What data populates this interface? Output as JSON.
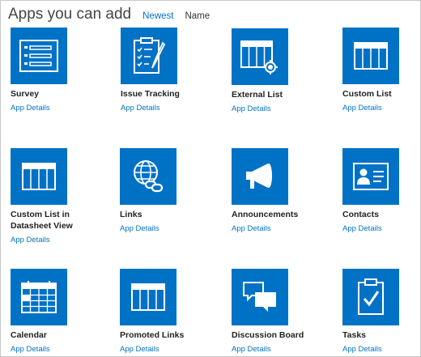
{
  "header": {
    "title": "Apps you can add",
    "sort_newest": "Newest",
    "sort_name": "Name"
  },
  "apps": [
    {
      "name": "Survey",
      "details": "App Details",
      "icon": "survey-icon"
    },
    {
      "name": "Issue Tracking",
      "details": "App Details",
      "icon": "issue-tracking-icon"
    },
    {
      "name": "External List",
      "details": "App Details",
      "icon": "external-list-icon"
    },
    {
      "name": "Custom List",
      "details": "App Details",
      "icon": "custom-list-icon"
    },
    {
      "name": "Custom List in Datasheet View",
      "details": "App Details",
      "icon": "datasheet-icon"
    },
    {
      "name": "Links",
      "details": "App Details",
      "icon": "links-icon"
    },
    {
      "name": "Announcements",
      "details": "App Details",
      "icon": "announcements-icon"
    },
    {
      "name": "Contacts",
      "details": "App Details",
      "icon": "contacts-icon"
    },
    {
      "name": "Calendar",
      "details": "App Details",
      "icon": "calendar-icon"
    },
    {
      "name": "Promoted Links",
      "details": "App Details",
      "icon": "promoted-links-icon"
    },
    {
      "name": "Discussion Board",
      "details": "App Details",
      "icon": "discussion-board-icon"
    },
    {
      "name": "Tasks",
      "details": "App Details",
      "icon": "tasks-icon"
    }
  ],
  "colors": {
    "tile": "#0072c6",
    "link": "#0072c6"
  }
}
